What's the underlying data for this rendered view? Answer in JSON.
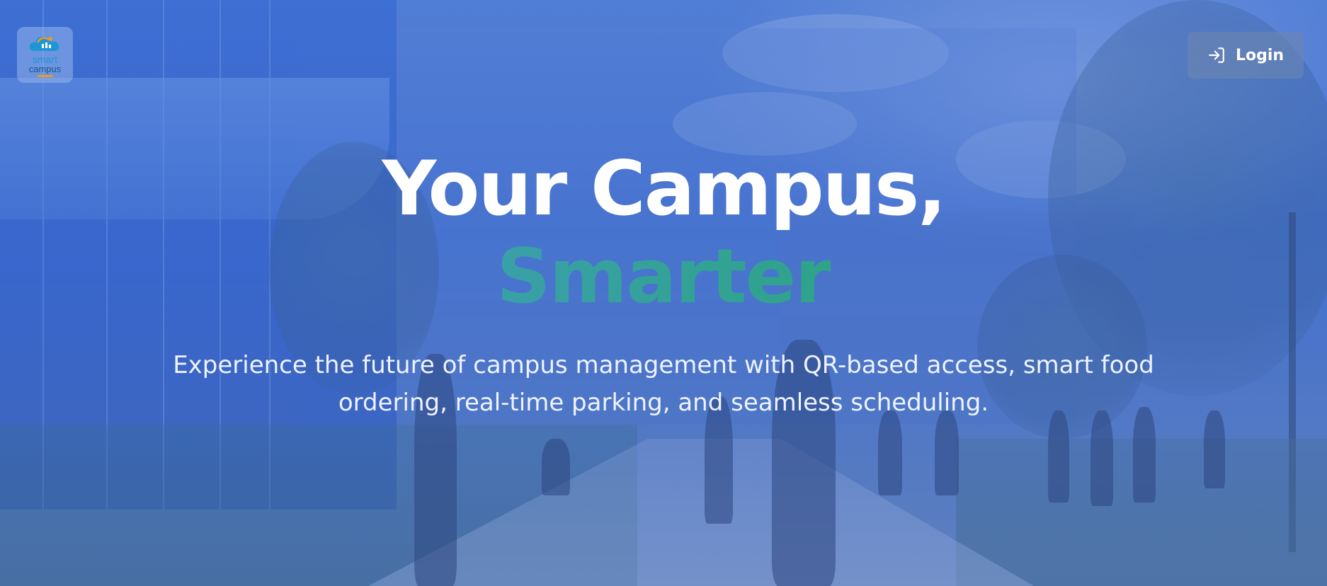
{
  "logo": {
    "line1": "smart",
    "line2": "campus",
    "colors": {
      "primary": "#1e96d6",
      "secondary": "#135a8c",
      "accent": "#e89a2b"
    }
  },
  "header": {
    "login_label": "Login",
    "login_icon": "login-icon"
  },
  "hero": {
    "headline": "Your Campus,",
    "headline_accent": "Smarter",
    "subtitle_line1": "Experience the future of campus management with QR-based access, smart food",
    "subtitle_line2": "ordering, real-time parking, and seamless scheduling.",
    "accent_colors": [
      "#3aa0a8",
      "#2ea389"
    ]
  }
}
